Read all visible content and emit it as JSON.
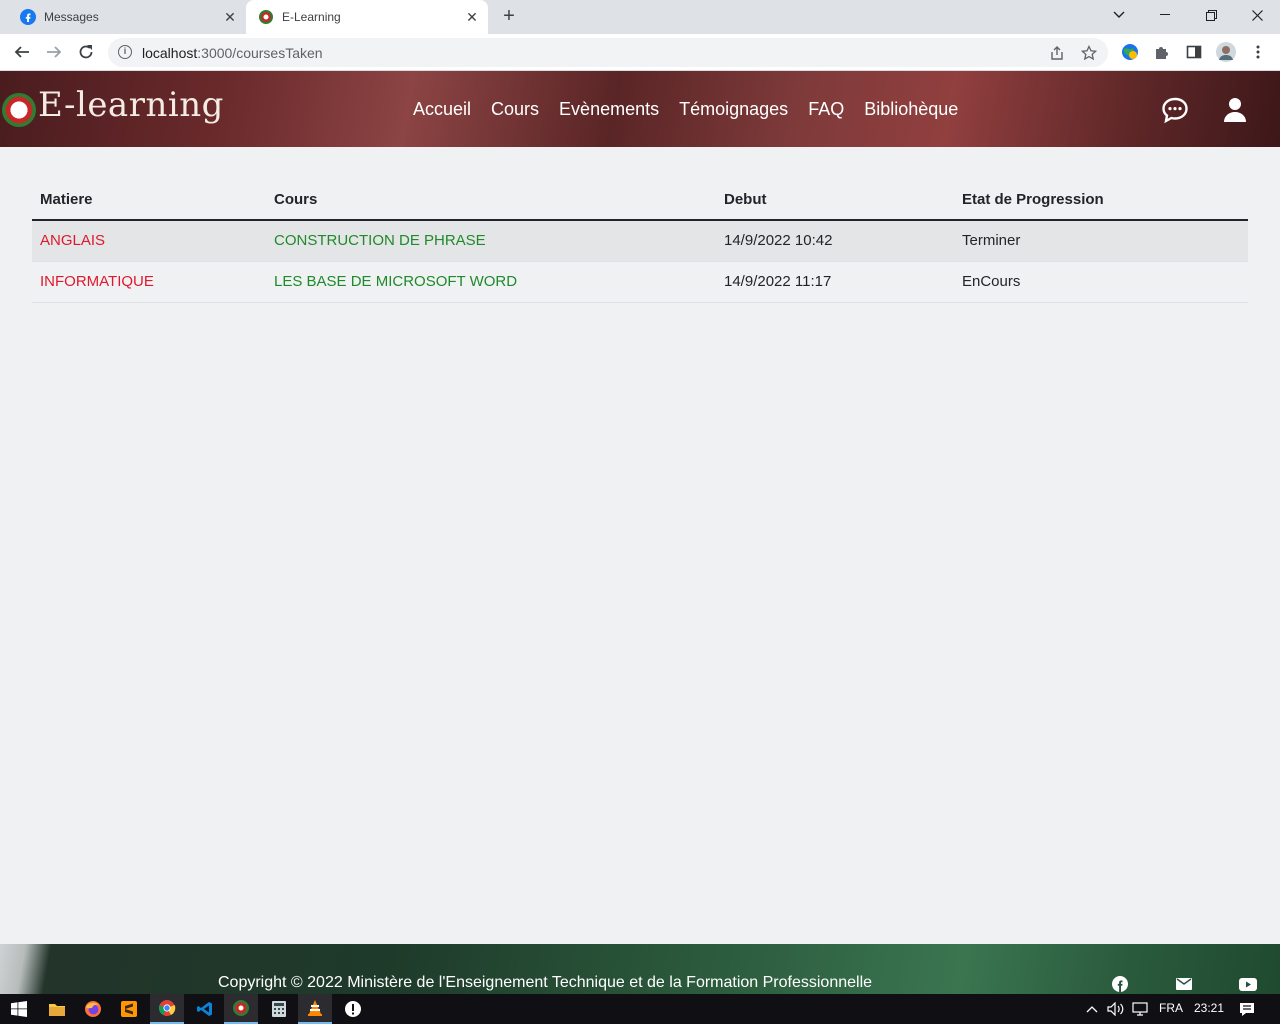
{
  "browser": {
    "tabs": [
      {
        "title": "Messages",
        "icon": "facebook-icon"
      },
      {
        "title": "E-Learning",
        "icon": "elearning-logo-icon"
      }
    ],
    "url_host": "localhost",
    "url_path": ":3000/coursesTaken"
  },
  "site": {
    "logo_text": "E-learning",
    "nav": [
      "Accueil",
      "Cours",
      "Evènements",
      "Témoignages",
      "FAQ",
      "Bibliohèque"
    ]
  },
  "table": {
    "headers": [
      "Matiere",
      "Cours",
      "Debut",
      "Etat de Progression"
    ],
    "rows": [
      {
        "matiere": "ANGLAIS",
        "cours": "CONSTRUCTION DE PHRASE",
        "debut": "14/9/2022 10:42",
        "etat": "Terminer"
      },
      {
        "matiere": "INFORMATIQUE",
        "cours": "LES BASE DE MICROSOFT WORD",
        "debut": "14/9/2022 11:17",
        "etat": "EnCours"
      }
    ]
  },
  "footer": {
    "copyright": "Copyright © 2022 Ministère de l'Enseignement Technique et de la Formation Professionnelle"
  },
  "taskbar": {
    "language": "FRA",
    "time": "23:21"
  },
  "colors": {
    "subject": "#e0182d",
    "course": "#1e8a2b",
    "header_bg": "#7e3a3a",
    "footer_bg": "#2b5a3c"
  }
}
